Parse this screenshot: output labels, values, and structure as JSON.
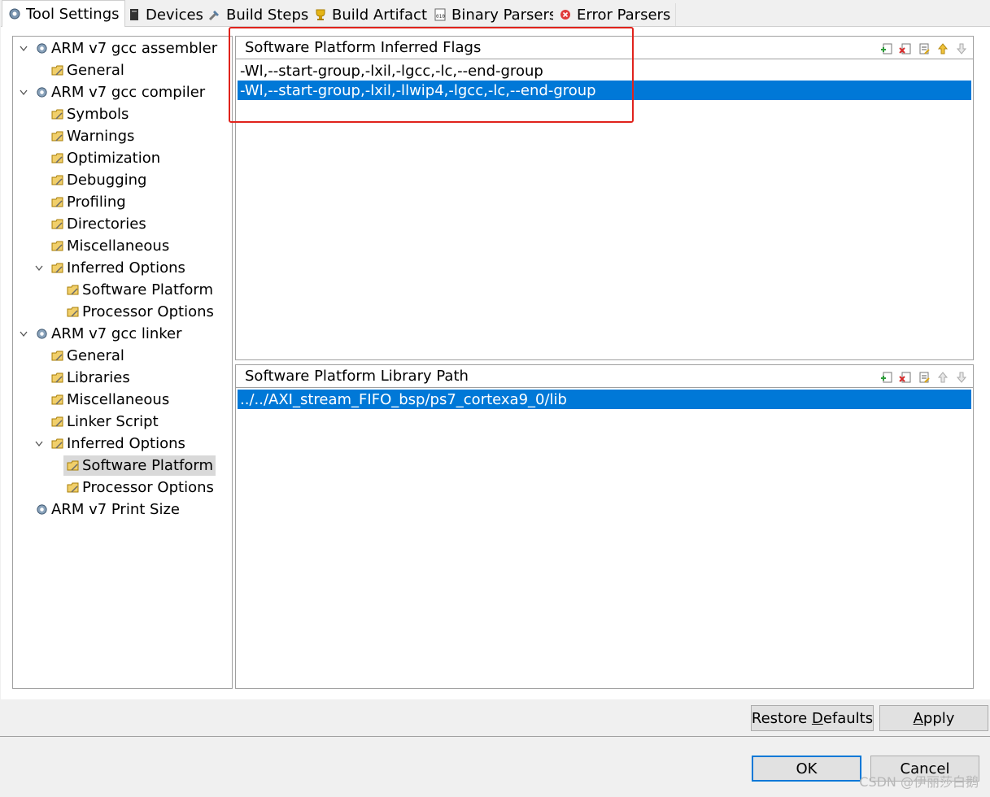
{
  "tabs": [
    {
      "label": "Tool Settings",
      "icon": "tool-settings-icon",
      "active": true
    },
    {
      "label": "Devices",
      "icon": "device-icon"
    },
    {
      "label": "Build Steps",
      "icon": "build-steps-icon"
    },
    {
      "label": "Build Artifact",
      "icon": "trophy-icon"
    },
    {
      "label": "Binary Parsers",
      "icon": "binary-icon"
    },
    {
      "label": "Error Parsers",
      "icon": "error-icon"
    }
  ],
  "tree": [
    {
      "label": "ARM v7 gcc assembler",
      "level": 0,
      "expanded": true,
      "icon": "tool-icon"
    },
    {
      "label": "General",
      "level": 1,
      "icon": "option-category-icon"
    },
    {
      "label": "ARM v7 gcc compiler",
      "level": 0,
      "expanded": true,
      "icon": "tool-icon"
    },
    {
      "label": "Symbols",
      "level": 1,
      "icon": "option-category-icon"
    },
    {
      "label": "Warnings",
      "level": 1,
      "icon": "option-category-icon"
    },
    {
      "label": "Optimization",
      "level": 1,
      "icon": "option-category-icon"
    },
    {
      "label": "Debugging",
      "level": 1,
      "icon": "option-category-icon"
    },
    {
      "label": "Profiling",
      "level": 1,
      "icon": "option-category-icon"
    },
    {
      "label": "Directories",
      "level": 1,
      "icon": "option-category-icon"
    },
    {
      "label": "Miscellaneous",
      "level": 1,
      "icon": "option-category-icon"
    },
    {
      "label": "Inferred Options",
      "level": 1,
      "expanded": true,
      "icon": "option-category-icon"
    },
    {
      "label": "Software Platform",
      "level": 2,
      "icon": "option-category-icon"
    },
    {
      "label": "Processor Options",
      "level": 2,
      "icon": "option-category-icon"
    },
    {
      "label": "ARM v7 gcc linker",
      "level": 0,
      "expanded": true,
      "icon": "tool-icon"
    },
    {
      "label": "General",
      "level": 1,
      "icon": "option-category-icon"
    },
    {
      "label": "Libraries",
      "level": 1,
      "icon": "option-category-icon"
    },
    {
      "label": "Miscellaneous",
      "level": 1,
      "icon": "option-category-icon"
    },
    {
      "label": "Linker Script",
      "level": 1,
      "icon": "option-category-icon"
    },
    {
      "label": "Inferred Options",
      "level": 1,
      "expanded": true,
      "icon": "option-category-icon"
    },
    {
      "label": "Software Platform",
      "level": 2,
      "icon": "option-category-icon",
      "selected": true
    },
    {
      "label": "Processor Options",
      "level": 2,
      "icon": "option-category-icon"
    },
    {
      "label": "ARM v7 Print Size",
      "level": 0,
      "icon": "tool-icon"
    }
  ],
  "flags_group": {
    "title": "Software Platform Inferred Flags",
    "items": [
      {
        "text": "-Wl,--start-group,-lxil,-lgcc,-lc,--end-group",
        "selected": false
      },
      {
        "text": "-Wl,--start-group,-lxil,-llwip4,-lgcc,-lc,--end-group",
        "selected": true
      }
    ]
  },
  "libpath_group": {
    "title": "Software Platform Library Path",
    "items": [
      {
        "text": "../../AXI_stream_FIFO_bsp/ps7_cortexa9_0/lib",
        "selected": true
      }
    ]
  },
  "buttons": {
    "restore_defaults_pre": "Restore ",
    "restore_defaults_key": "D",
    "restore_defaults_post": "efaults",
    "apply_key": "A",
    "apply_post": "pply",
    "ok": "OK",
    "cancel": "Cancel"
  },
  "watermark": "CSDN @伊丽莎白鹅",
  "colors": {
    "selection": "#0078d7",
    "highlight_box": "#e0231c"
  }
}
